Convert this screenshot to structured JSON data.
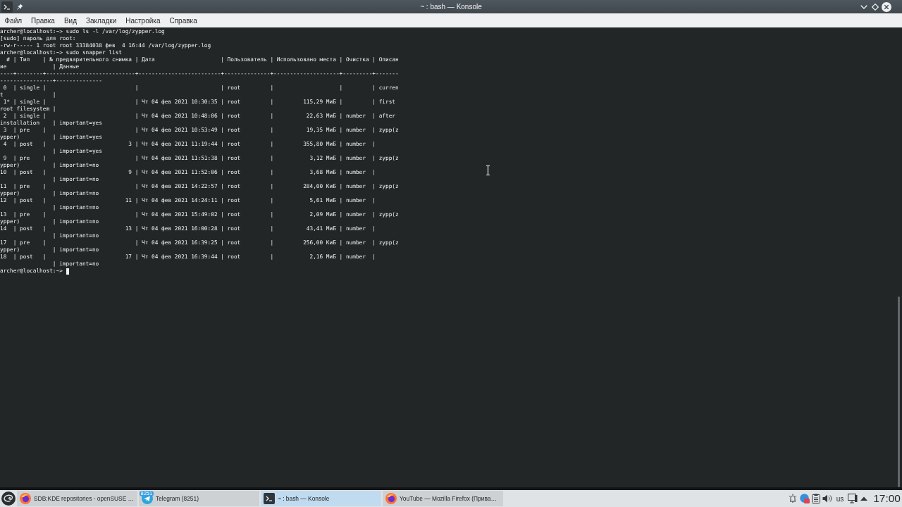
{
  "window": {
    "title": "~ : bash — Konsole"
  },
  "menu": [
    "Файл",
    "Правка",
    "Вид",
    "Закладки",
    "Настройка",
    "Справка"
  ],
  "terminal": {
    "lines": [
      "archer@localhost:~> sudo ls -l /var/log/zypper.log",
      "[sudo] пароль для root:",
      "-rw-r----- 1 root root 33384038 фев  4 16:44 /var/log/zypper.log",
      "archer@localhost:~> sudo snapper list",
      "  # | Тип    | № предварительного снимка | Дата                    | Пользователь | Использовано места | Очистка | Описан",
      "ие              | Данные",
      "----+--------+---------------------------+-------------------------+--------------+--------------------+---------+-------",
      "----------------+--------------",
      " 0  | single |                           |                         | root         |                    |         | curren",
      "t               |",
      " 1* | single |                           | Чт 04 фев 2021 10:30:35 | root         |         115,29 МиБ |         | first",
      "root filesystem |",
      " 2  | single |                           | Чт 04 фев 2021 10:48:06 | root         |          22,63 МиБ | number  | after",
      "installation    | important=yes",
      " 3  | pre    |                           | Чт 04 фев 2021 10:53:49 | root         |          19,35 МиБ | number  | zypp(z",
      "ypper)          | important=yes",
      " 4  | post   |                         3 | Чт 04 фев 2021 11:19:44 | root         |         355,80 МиБ | number  |",
      "                | important=yes",
      " 9  | pre    |                           | Чт 04 фев 2021 11:51:38 | root         |           3,12 МиБ | number  | zypp(z",
      "ypper)          | important=no",
      "10  | post   |                         9 | Чт 04 фев 2021 11:52:06 | root         |           3,68 МиБ | number  |",
      "                | important=no",
      "11  | pre    |                           | Чт 04 фев 2021 14:22:57 | root         |         284,00 КиБ | number  | zypp(z",
      "ypper)          | important=no",
      "12  | post   |                        11 | Чт 04 фев 2021 14:24:11 | root         |           5,61 МиБ | number  |",
      "                | important=no",
      "13  | pre    |                           | Чт 04 фев 2021 15:49:02 | root         |           2,09 МиБ | number  | zypp(z",
      "ypper)          | important=no",
      "14  | post   |                        13 | Чт 04 фев 2021 16:00:28 | root         |          43,41 МиБ | number  |",
      "                | important=no",
      "17  | pre    |                           | Чт 04 фев 2021 16:39:25 | root         |         256,00 КиБ | number  | zypp(z",
      "ypper)          | important=no",
      "18  | post   |                        17 | Чт 04 фев 2021 16:39:44 | root         |           2,16 МиБ | number  |",
      "                | important=no"
    ],
    "prompt": "archer@localhost:~>"
  },
  "taskbar": {
    "tasks": [
      {
        "kind": "browser",
        "title": "SDB:KDE repositories - openSUSE …",
        "selected": false
      },
      {
        "kind": "messenger",
        "title": "Telegram (8251)",
        "badge": "8251",
        "selected": false
      },
      {
        "kind": "terminal",
        "title": "~ : bash — Konsole",
        "selected": true
      },
      {
        "kind": "browser",
        "title": "YouTube — Mozilla Firefox (Прива…",
        "selected": false
      }
    ],
    "keyboard_layout": "us",
    "clock": "17:00"
  }
}
